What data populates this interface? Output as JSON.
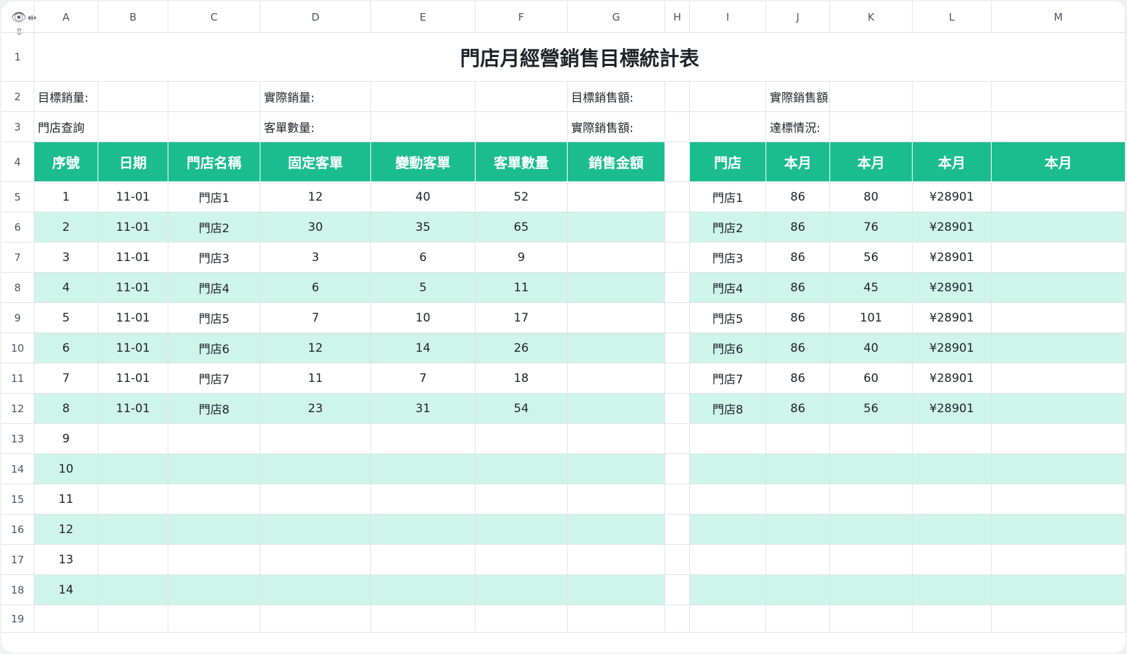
{
  "columns": [
    "A",
    "B",
    "C",
    "D",
    "E",
    "F",
    "G",
    "H",
    "I",
    "J",
    "K",
    "L",
    "M"
  ],
  "row_numbers": [
    "1",
    "2",
    "3",
    "4",
    "5",
    "6",
    "7",
    "8",
    "9",
    "10",
    "11",
    "12",
    "13",
    "14",
    "15",
    "16",
    "17",
    "18",
    "19"
  ],
  "title": "門店月經營銷售目標統計表",
  "info": {
    "target_qty": "目標銷量:",
    "actual_qty": "實際銷量:",
    "target_amount": "目標銷售額:",
    "actual_amount_a": "實際銷售額:",
    "store_query": "門店查詢",
    "order_count": "客單數量:",
    "actual_amount_b": "實際銷售額:",
    "status": "達標情況:"
  },
  "left_headers": [
    "序號",
    "日期",
    "門店名稱",
    "固定客單",
    "變動客單",
    "客單數量",
    "銷售金額"
  ],
  "right_headers": [
    "門店",
    "本月",
    "本月",
    "本月",
    "本月"
  ],
  "left_rows": [
    [
      "1",
      "11-01",
      "門店1",
      "12",
      "40",
      "52",
      ""
    ],
    [
      "2",
      "11-01",
      "門店2",
      "30",
      "35",
      "65",
      ""
    ],
    [
      "3",
      "11-01",
      "門店3",
      "3",
      "6",
      "9",
      ""
    ],
    [
      "4",
      "11-01",
      "門店4",
      "6",
      "5",
      "11",
      ""
    ],
    [
      "5",
      "11-01",
      "門店5",
      "7",
      "10",
      "17",
      ""
    ],
    [
      "6",
      "11-01",
      "門店6",
      "12",
      "14",
      "26",
      ""
    ],
    [
      "7",
      "11-01",
      "門店7",
      "11",
      "7",
      "18",
      ""
    ],
    [
      "8",
      "11-01",
      "門店8",
      "23",
      "31",
      "54",
      ""
    ],
    [
      "9",
      "",
      "",
      "",
      "",
      "",
      ""
    ],
    [
      "10",
      "",
      "",
      "",
      "",
      "",
      ""
    ],
    [
      "11",
      "",
      "",
      "",
      "",
      "",
      ""
    ],
    [
      "12",
      "",
      "",
      "",
      "",
      "",
      ""
    ],
    [
      "13",
      "",
      "",
      "",
      "",
      "",
      ""
    ],
    [
      "14",
      "",
      "",
      "",
      "",
      "",
      ""
    ]
  ],
  "right_rows": [
    [
      "門店1",
      "86",
      "80",
      "¥28901",
      ""
    ],
    [
      "門店2",
      "86",
      "76",
      "¥28901",
      ""
    ],
    [
      "門店3",
      "86",
      "56",
      "¥28901",
      ""
    ],
    [
      "門店4",
      "86",
      "45",
      "¥28901",
      ""
    ],
    [
      "門店5",
      "86",
      "101",
      "¥28901",
      ""
    ],
    [
      "門店6",
      "86",
      "40",
      "¥28901",
      ""
    ],
    [
      "門店7",
      "86",
      "60",
      "¥28901",
      ""
    ],
    [
      "門店8",
      "86",
      "56",
      "¥28901",
      ""
    ],
    [
      "",
      "",
      "",
      "",
      ""
    ],
    [
      "",
      "",
      "",
      "",
      ""
    ],
    [
      "",
      "",
      "",
      "",
      ""
    ],
    [
      "",
      "",
      "",
      "",
      ""
    ],
    [
      "",
      "",
      "",
      "",
      ""
    ],
    [
      "",
      "",
      "",
      "",
      ""
    ]
  ],
  "colors": {
    "header_green": "#1bbd8f",
    "band_mint": "#cff4ea",
    "grid": "#e1e3e6"
  },
  "icons": {
    "corner_view": "eye-icon",
    "col_resize": "column-resize-icon",
    "row_resize": "row-resize-icon"
  }
}
